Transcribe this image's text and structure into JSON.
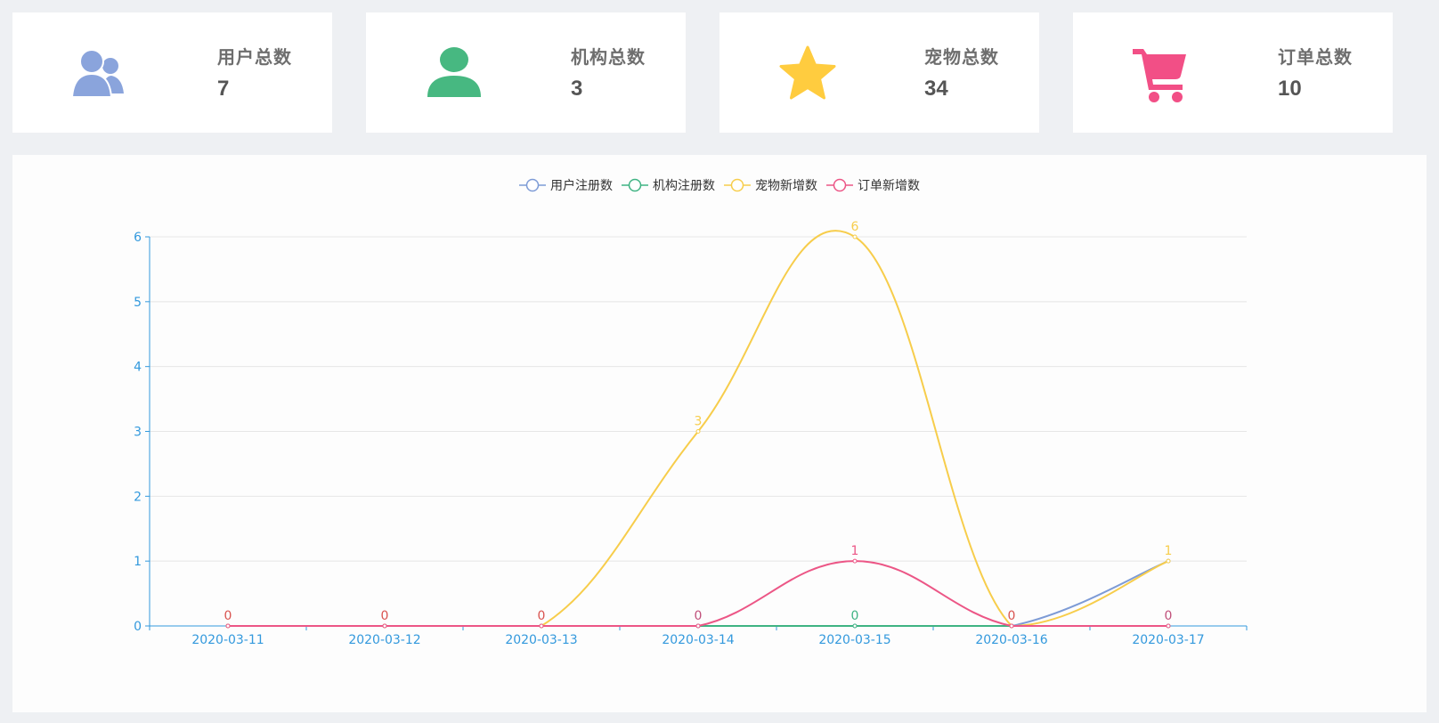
{
  "stats": [
    {
      "label": "用户总数",
      "value": "7",
      "icon": "users-icon",
      "color": "#8aa4dc"
    },
    {
      "label": "机构总数",
      "value": "3",
      "icon": "user-icon",
      "color": "#47b881"
    },
    {
      "label": "宠物总数",
      "value": "34",
      "icon": "star-icon",
      "color": "#ffcc3f"
    },
    {
      "label": "订单总数",
      "value": "10",
      "icon": "cart-icon",
      "color": "#f24f86"
    }
  ],
  "chart_data": {
    "type": "line",
    "smooth": true,
    "categories": [
      "2020-03-11",
      "2020-03-12",
      "2020-03-13",
      "2020-03-14",
      "2020-03-15",
      "2020-03-16",
      "2020-03-17"
    ],
    "ylim": [
      0,
      6
    ],
    "yticks": [
      0,
      1,
      2,
      3,
      4,
      5,
      6
    ],
    "grid": true,
    "legend_position": "top-center",
    "axis_color": "#3399dd",
    "series": [
      {
        "name": "用户注册数",
        "color": "#7d9bd6",
        "values": [
          0,
          0,
          0,
          0,
          0,
          0,
          1
        ]
      },
      {
        "name": "机构注册数",
        "color": "#3fb383",
        "values": [
          0,
          0,
          0,
          0,
          0,
          0,
          0
        ]
      },
      {
        "name": "宠物新增数",
        "color": "#f7cd4b",
        "values": [
          0,
          0,
          0,
          3,
          6,
          0,
          1
        ]
      },
      {
        "name": "订单新增数",
        "color": "#ec5686",
        "values": [
          0,
          0,
          0,
          0,
          1,
          0,
          0
        ]
      }
    ],
    "data_labels": [
      {
        "series": 3,
        "values": [
          "0",
          "0",
          "0",
          "0",
          "1",
          "0",
          "0"
        ]
      },
      {
        "series": 2,
        "values": [
          null,
          null,
          null,
          "3",
          "6",
          null,
          "1"
        ]
      },
      {
        "series": 1,
        "values": [
          null,
          null,
          null,
          null,
          "0",
          null,
          null
        ]
      }
    ],
    "label_colors": [
      "#d9534f",
      "#d9534f",
      "#d9534f",
      "#c0507a",
      "#3fb383",
      "#d9534f",
      "#c0507a"
    ]
  }
}
